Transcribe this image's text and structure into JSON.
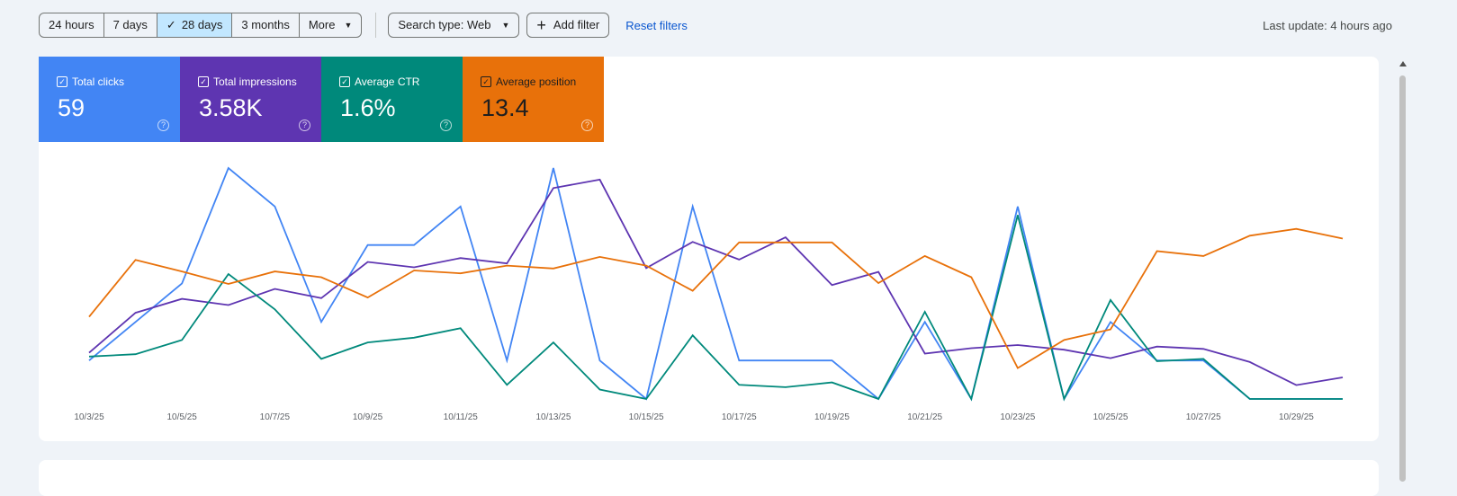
{
  "toolbar": {
    "ranges": [
      "24 hours",
      "7 days",
      "28 days",
      "3 months",
      "More"
    ],
    "active_range": "28 days",
    "search_type": "Search type: Web",
    "add_filter": "Add filter",
    "reset": "Reset filters",
    "last_update": "Last update: 4 hours ago"
  },
  "metrics": [
    {
      "label": "Total clicks",
      "value": "59",
      "color": "#4285f4"
    },
    {
      "label": "Total impressions",
      "value": "3.58K",
      "color": "#5e35b1"
    },
    {
      "label": "Average CTR",
      "value": "1.6%",
      "color": "#00897b"
    },
    {
      "label": "Average position",
      "value": "13.4",
      "color": "#e8710a"
    }
  ],
  "chart_data": {
    "type": "line",
    "x": [
      "10/3/25",
      "10/4/25",
      "10/5/25",
      "10/6/25",
      "10/7/25",
      "10/8/25",
      "10/9/25",
      "10/10/25",
      "10/11/25",
      "10/12/25",
      "10/13/25",
      "10/14/25",
      "10/15/25",
      "10/16/25",
      "10/17/25",
      "10/18/25",
      "10/19/25",
      "10/20/25",
      "10/21/25",
      "10/22/25",
      "10/23/25",
      "10/24/25",
      "10/25/25",
      "10/26/25",
      "10/27/25",
      "10/28/25",
      "10/29/25",
      "10/30/25"
    ],
    "tick_labels": [
      "10/3/25",
      "10/5/25",
      "10/7/25",
      "10/9/25",
      "10/11/25",
      "10/13/25",
      "10/15/25",
      "10/17/25",
      "10/19/25",
      "10/21/25",
      "10/23/25",
      "10/25/25",
      "10/27/25",
      "10/29/25"
    ],
    "grid": false,
    "series": [
      {
        "name": "Total clicks",
        "color": "#4285f4",
        "ylim": [
          0,
          6
        ],
        "values": [
          1,
          2,
          3,
          6,
          5,
          2,
          4,
          4,
          5,
          1,
          6,
          1,
          0,
          5,
          1,
          1,
          1,
          0,
          2,
          0,
          5,
          0,
          2,
          1,
          1,
          0,
          0,
          0
        ]
      },
      {
        "name": "Total impressions",
        "color": "#5e35b1",
        "ylim": [
          0,
          300
        ],
        "values": [
          60,
          112,
          130,
          122,
          143,
          131,
          178,
          171,
          183,
          176,
          274,
          285,
          170,
          204,
          181,
          210,
          148,
          165,
          59,
          66,
          70,
          64,
          53,
          68,
          65,
          48,
          18,
          28
        ]
      },
      {
        "name": "Average CTR",
        "color": "#00897b",
        "ylim": [
          0,
          9.8
        ],
        "values": [
          1.8,
          1.9,
          2.5,
          5.3,
          3.8,
          1.7,
          2.4,
          2.6,
          3.0,
          0.6,
          2.4,
          0.4,
          0,
          2.7,
          0.6,
          0.5,
          0.7,
          0,
          3.7,
          0,
          7.8,
          0,
          4.2,
          1.6,
          1.7,
          0,
          0,
          0
        ]
      },
      {
        "name": "Average position",
        "color": "#e8710a",
        "ylim": [
          2.1,
          26
        ],
        "reversed": true,
        "values": [
          17.5,
          11.6,
          12.8,
          14.1,
          12.8,
          13.4,
          15.5,
          12.7,
          13.0,
          12.2,
          12.5,
          11.3,
          12.2,
          14.8,
          9.8,
          9.8,
          9.8,
          14.0,
          11.2,
          13.4,
          22.8,
          19.9,
          18.8,
          10.7,
          11.2,
          9.1,
          8.4,
          9.4
        ]
      }
    ]
  }
}
